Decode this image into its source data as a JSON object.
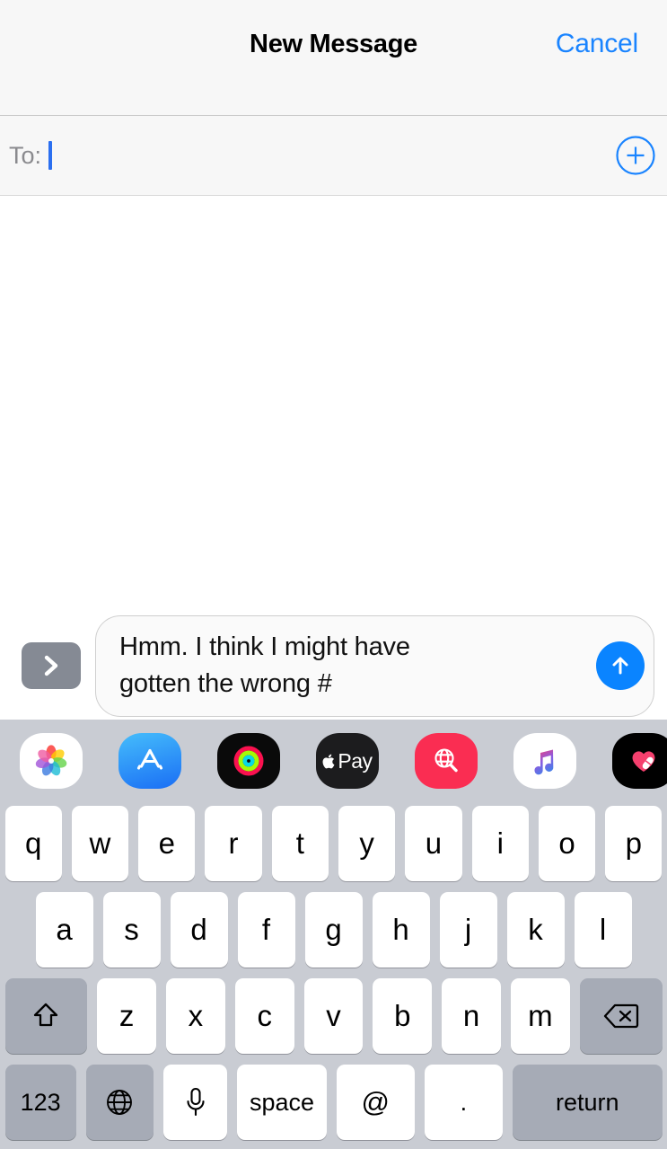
{
  "navbar": {
    "title": "New Message",
    "cancel_label": "Cancel",
    "cancel_color": "#1a84ff"
  },
  "to_field": {
    "label": "To:",
    "value": "",
    "caret_color": "#2b6ff0",
    "add_contact_icon": "plus-circle-icon"
  },
  "input_toolbar": {
    "expand_apps_icon": "chevron-right-icon",
    "message_text": "Hmm. I think I might have gotten the wrong #",
    "send_icon": "arrow-up-icon",
    "send_color": "#0a84ff"
  },
  "app_strip": {
    "apps": [
      {
        "name": "Photos",
        "icon": "photos-icon"
      },
      {
        "name": "App Store",
        "icon": "app-store-icon"
      },
      {
        "name": "Activity",
        "icon": "activity-rings-icon"
      },
      {
        "name": "Apple Pay",
        "icon": "apple-pay-icon",
        "label": "Pay"
      },
      {
        "name": "#images",
        "icon": "images-search-icon"
      },
      {
        "name": "Apple Music",
        "icon": "music-note-icon"
      },
      {
        "name": "Digital Touch",
        "icon": "heart-icon"
      }
    ]
  },
  "keyboard": {
    "row1": [
      "q",
      "w",
      "e",
      "r",
      "t",
      "y",
      "u",
      "i",
      "o",
      "p"
    ],
    "row2": [
      "a",
      "s",
      "d",
      "f",
      "g",
      "h",
      "j",
      "k",
      "l"
    ],
    "row3": [
      "z",
      "x",
      "c",
      "v",
      "b",
      "n",
      "m"
    ],
    "shift_icon": "shift-arrow-icon",
    "delete_icon": "backspace-icon",
    "numeric_label": "123",
    "globe_icon": "globe-icon",
    "mic_icon": "microphone-icon",
    "space_label": "space",
    "at_label": "@",
    "period_label": ".",
    "return_label": "return"
  }
}
